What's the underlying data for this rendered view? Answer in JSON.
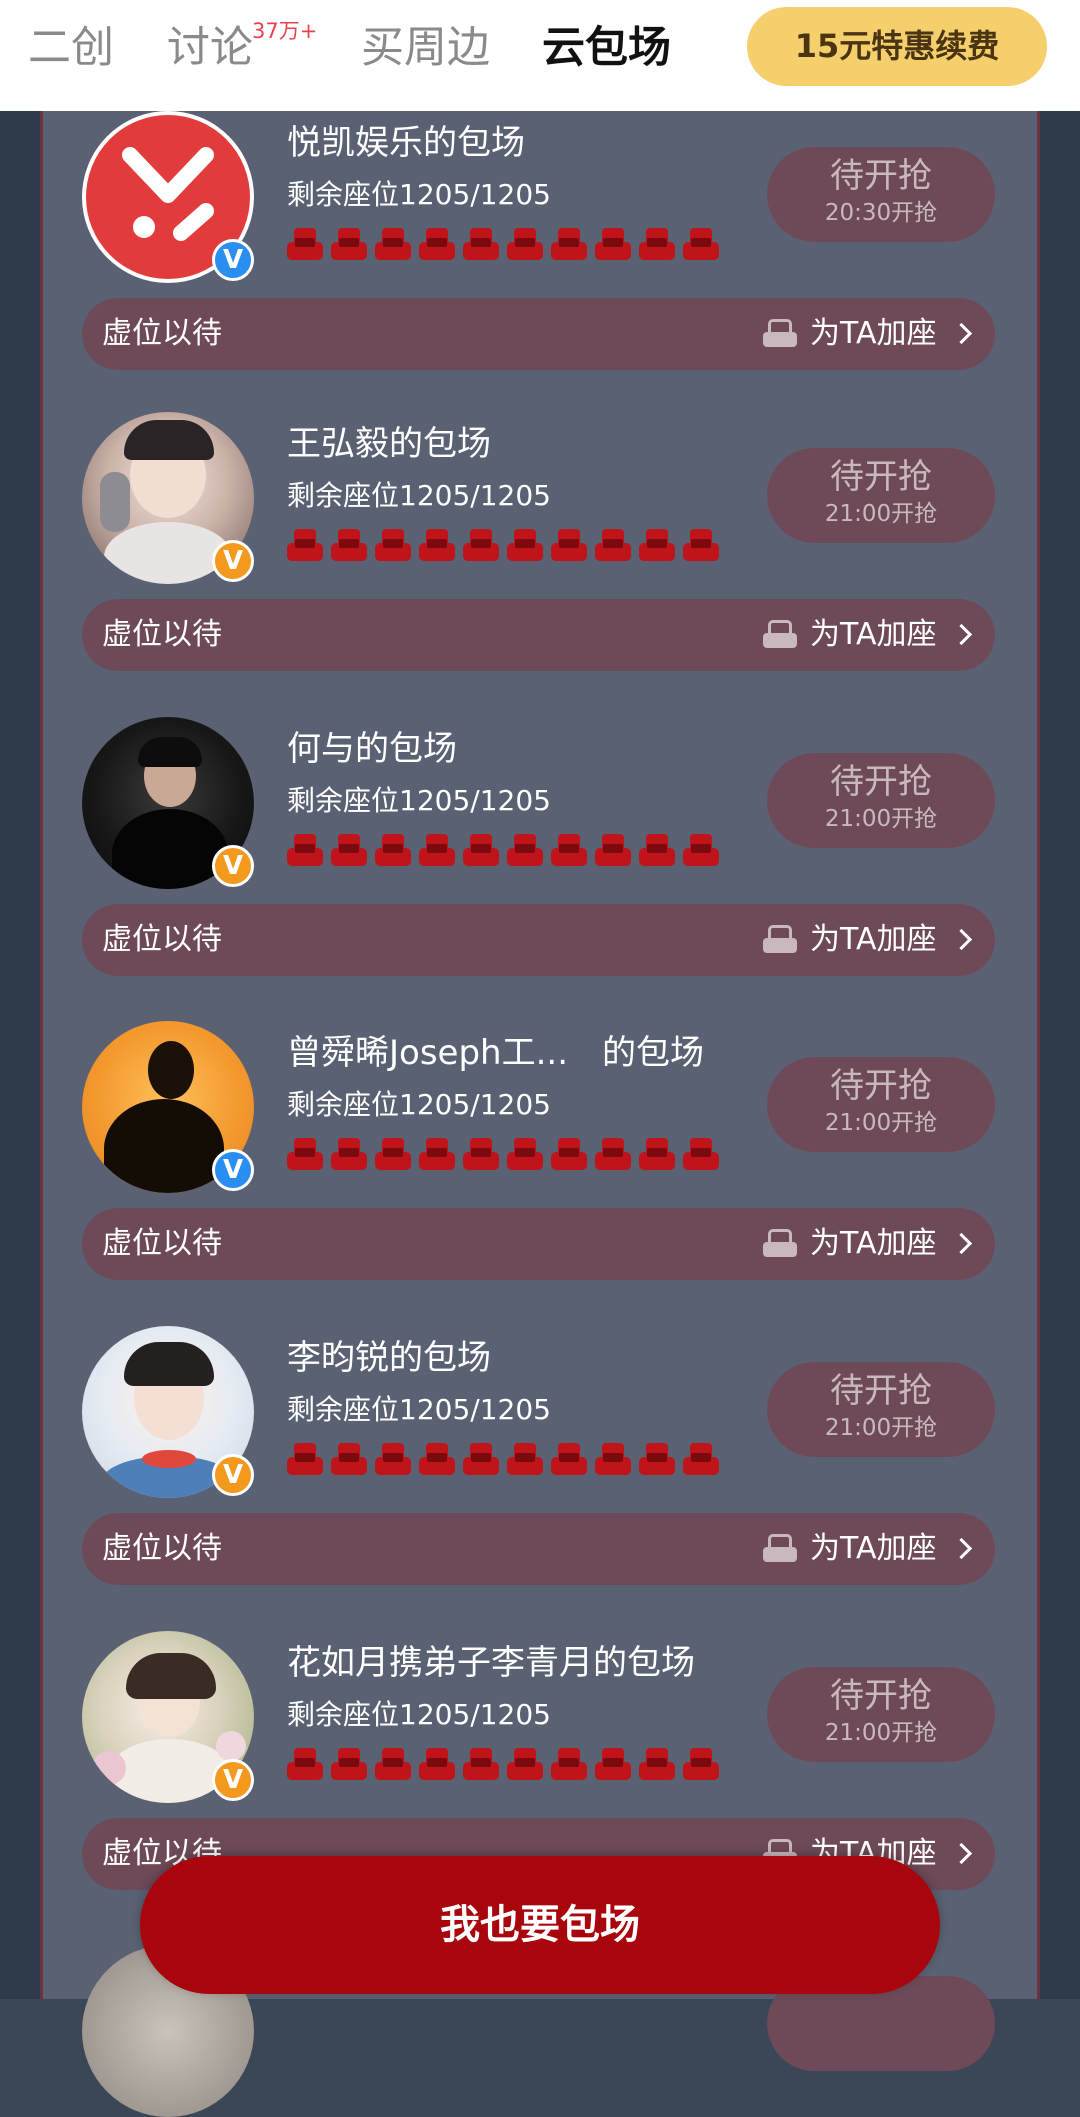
{
  "nav": {
    "tabs": [
      {
        "label": "二创"
      },
      {
        "label": "讨论",
        "badge": "37万+"
      },
      {
        "label": "买周边"
      },
      {
        "label": "云包场",
        "active": true
      }
    ],
    "renew_button": "15元特惠续费"
  },
  "colors": {
    "seat_red": "#c0141a",
    "cta_red": "#a8050c",
    "renew_yellow": "#f4cf6b",
    "card_pill": "#6e4a58",
    "panel_bg": "#5a6173"
  },
  "cards": [
    {
      "title": "悦凯娱乐的包场",
      "seats": "剩余座位1205/1205",
      "status": "待开抢",
      "time": "20:30开抢",
      "footer_left": "虚位以待",
      "footer_right": "为TA加座",
      "verify_badge": "V",
      "badge_color": "blue",
      "avatar_icon": "yuekai-logo-icon"
    },
    {
      "title": "王弘毅的包场",
      "seats": "剩余座位1205/1205",
      "status": "待开抢",
      "time": "21:00开抢",
      "footer_left": "虚位以待",
      "footer_right": "为TA加座",
      "verify_badge": "V",
      "badge_color": "orange",
      "avatar_icon": "avatar-photo"
    },
    {
      "title": "何与的包场",
      "seats": "剩余座位1205/1205",
      "status": "待开抢",
      "time": "21:00开抢",
      "footer_left": "虚位以待",
      "footer_right": "为TA加座",
      "verify_badge": "V",
      "badge_color": "orange",
      "avatar_icon": "avatar-photo"
    },
    {
      "title": "曾舜晞Joseph工...　的包场",
      "seats": "剩余座位1205/1205",
      "status": "待开抢",
      "time": "21:00开抢",
      "footer_left": "虚位以待",
      "footer_right": "为TA加座",
      "verify_badge": "V",
      "badge_color": "blue",
      "avatar_icon": "silhouette-avatar"
    },
    {
      "title": "李昀锐的包场",
      "seats": "剩余座位1205/1205",
      "status": "待开抢",
      "time": "21:00开抢",
      "footer_left": "虚位以待",
      "footer_right": "为TA加座",
      "verify_badge": "V",
      "badge_color": "orange",
      "avatar_icon": "avatar-photo"
    },
    {
      "title": "花如月携弟子李青月的包场",
      "seats": "剩余座位1205/1205",
      "status": "待开抢",
      "time": "21:00开抢",
      "footer_left": "虚位以待",
      "footer_right": "为TA加座",
      "verify_badge": "V",
      "badge_color": "orange",
      "avatar_icon": "avatar-photo"
    }
  ],
  "seat_icons_per_row": 10,
  "cta_button": "我也要包场"
}
